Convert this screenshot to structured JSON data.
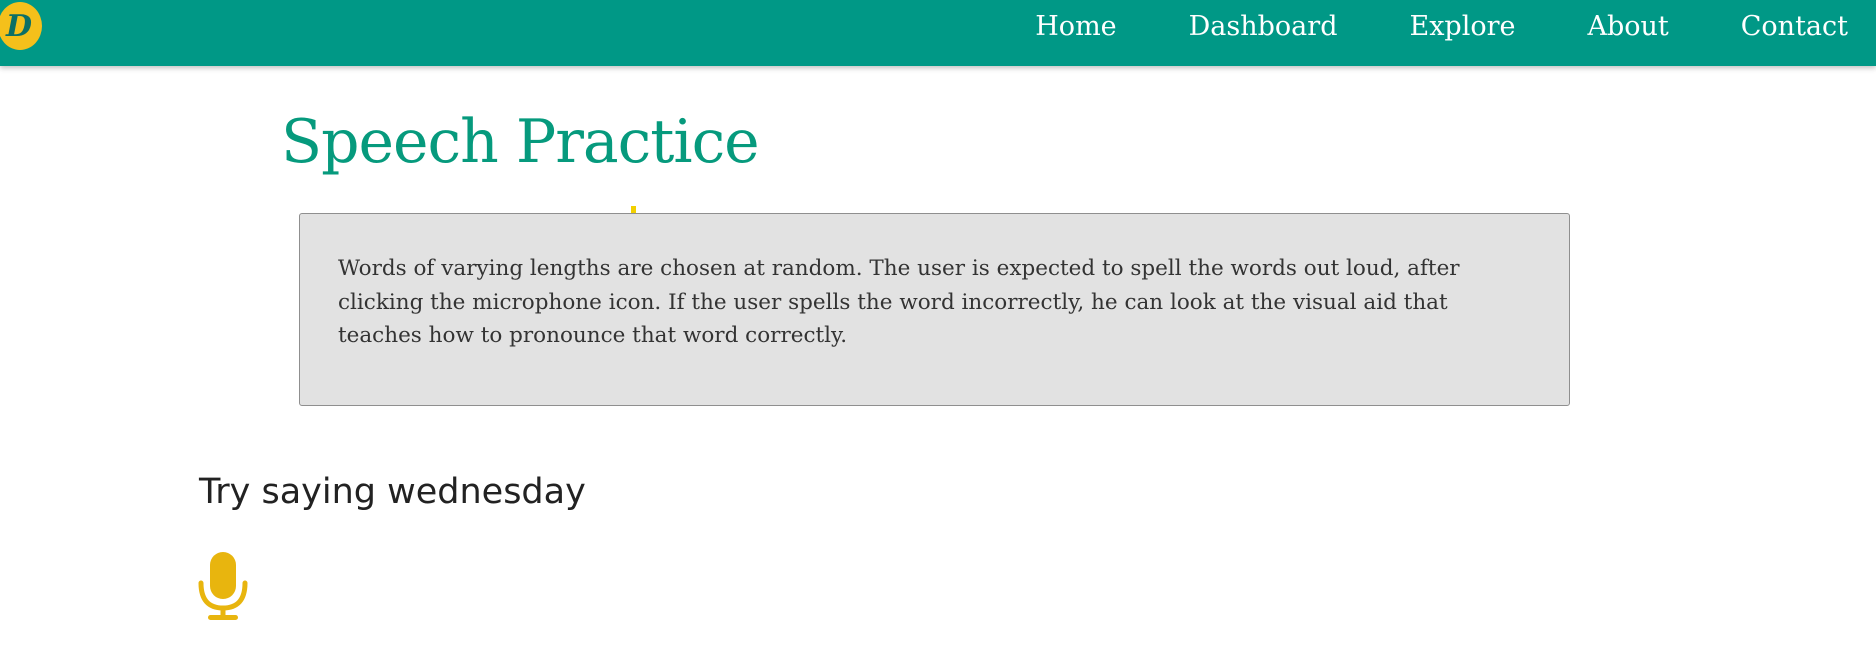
{
  "colors": {
    "navbar": "#009886",
    "title": "#069a7d",
    "logo_fill": "#f5c01b",
    "mic": "#e8b50e",
    "description_bg": "#e2e2e2"
  },
  "navbar": {
    "logo_letter": "D",
    "links": [
      {
        "label": "Home"
      },
      {
        "label": "Dashboard"
      },
      {
        "label": "Explore"
      },
      {
        "label": "About"
      },
      {
        "label": "Contact"
      }
    ]
  },
  "main": {
    "title": "Speech Practice",
    "description": "Words of varying lengths are chosen at random. The user is expected to spell the words out loud, after clicking the microphone icon. If the user spells the word incorrectly, he can look at the visual aid that teaches how to pronounce that word correctly.",
    "prompt": "Try saying wednesday",
    "mic_icon": "microphone-icon"
  }
}
